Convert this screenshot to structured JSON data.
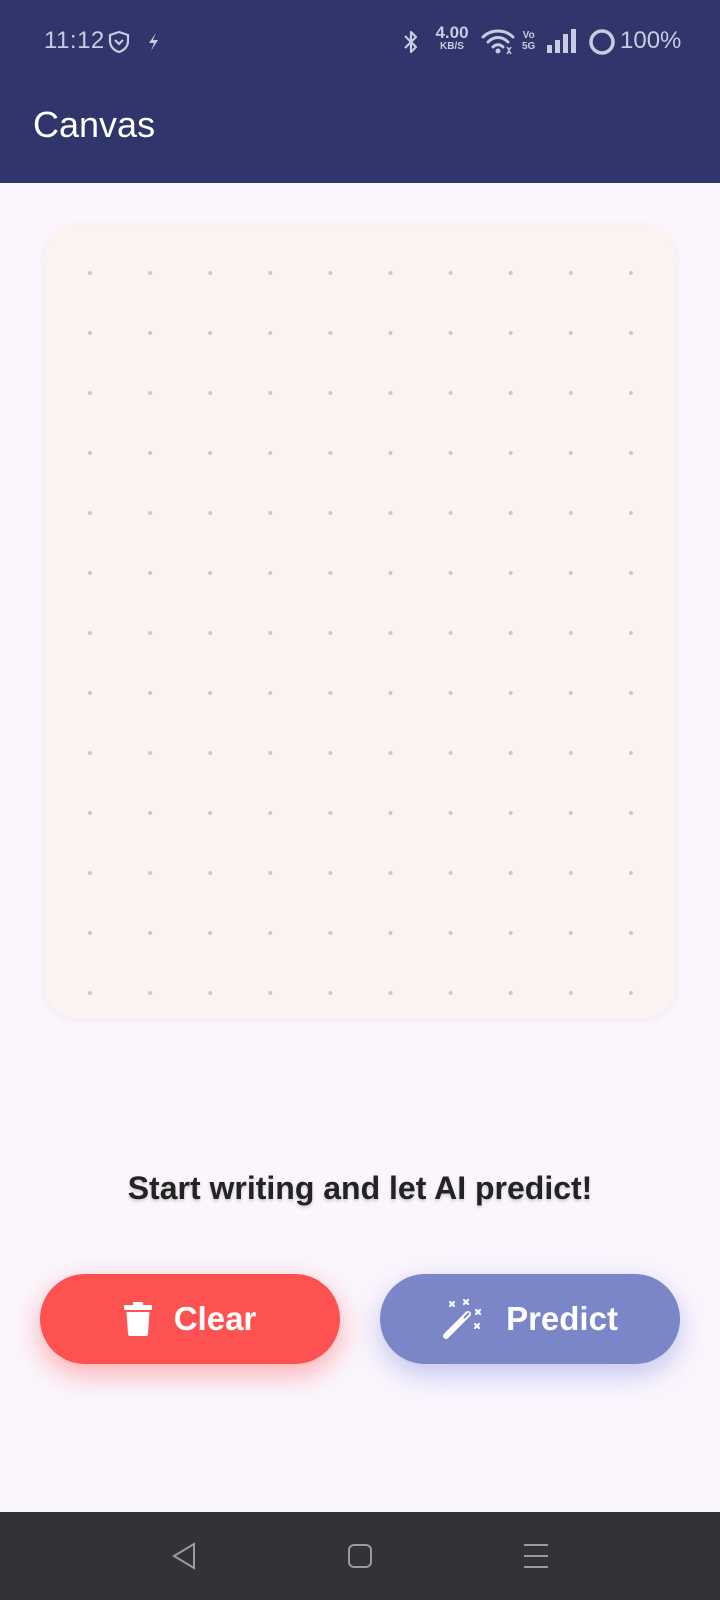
{
  "status_bar": {
    "time": "11:12",
    "net_speed_value": "4.00",
    "net_speed_unit": "KB/S",
    "volte_line1": "Vo",
    "volte_line2": "5G",
    "battery": "100%",
    "icons": [
      "shield-icon",
      "bolt-icon",
      "bluetooth-icon",
      "wifi-icon",
      "signal-icon",
      "battery-ring-icon"
    ]
  },
  "app_bar": {
    "title": "Canvas"
  },
  "canvas": {
    "dot_grid": {
      "columns": 10,
      "rows": 13
    },
    "colors": {
      "background": "#fcf2f2",
      "dot": "#cfc6ca"
    }
  },
  "hint_text": "Start writing and let AI predict!",
  "buttons": {
    "clear": {
      "label": "Clear",
      "icon": "trash-icon",
      "color": "#fe5151"
    },
    "predict": {
      "label": "Predict",
      "icon": "magic-wand-icon",
      "color": "#7a86c7"
    }
  },
  "nav_bar": {
    "icons": [
      "back-icon",
      "home-icon",
      "menu-icon"
    ]
  },
  "theme": {
    "primary": "#30356b",
    "background": "#fbf6fd"
  }
}
